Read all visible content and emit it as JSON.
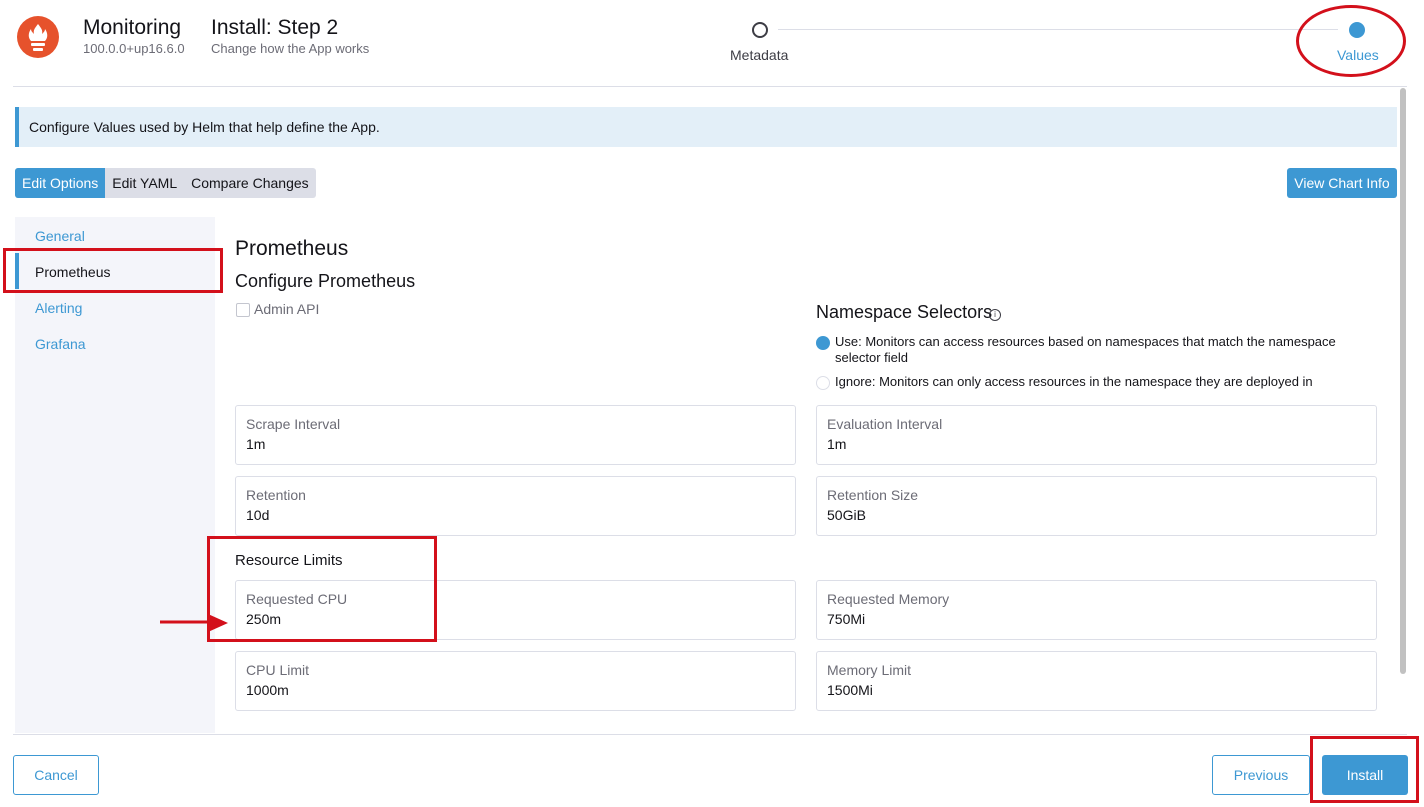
{
  "header": {
    "app_name": "Monitoring",
    "app_version": "100.0.0+up16.6.0",
    "step_title": "Install: Step 2",
    "step_subtitle": "Change how the App works",
    "steps": [
      {
        "label": "Metadata",
        "state": "complete"
      },
      {
        "label": "Values",
        "state": "active"
      }
    ],
    "logo_icon": "prometheus-logo-icon"
  },
  "banner": {
    "text": "Configure Values used by Helm that help define the App."
  },
  "tabs": [
    {
      "label": "Edit Options",
      "active": true
    },
    {
      "label": "Edit YAML",
      "active": false
    },
    {
      "label": "Compare Changes",
      "active": false
    }
  ],
  "view_chart_info": "View Chart Info",
  "sidenav": [
    {
      "label": "General",
      "active": false
    },
    {
      "label": "Prometheus",
      "active": true
    },
    {
      "label": "Alerting",
      "active": false
    },
    {
      "label": "Grafana",
      "active": false
    }
  ],
  "content": {
    "section_title": "Prometheus",
    "subsection_title": "Configure Prometheus",
    "admin_api": {
      "label": "Admin API",
      "checked": false
    },
    "namespace_selectors": {
      "title": "Namespace Selectors",
      "info_icon": "info-icon",
      "options": [
        {
          "label": "Use: Monitors can access resources based on namespaces that match the namespace selector field",
          "selected": true
        },
        {
          "label": "Ignore: Monitors can only access resources in the namespace they are deployed in",
          "selected": false
        }
      ]
    },
    "fields": {
      "scrape_interval": {
        "label": "Scrape Interval",
        "value": "1m"
      },
      "evaluation_interval": {
        "label": "Evaluation Interval",
        "value": "1m"
      },
      "retention": {
        "label": "Retention",
        "value": "10d"
      },
      "retention_size": {
        "label": "Retention Size",
        "value": "50GiB"
      },
      "requested_cpu": {
        "label": "Requested CPU",
        "value": "250m"
      },
      "requested_memory": {
        "label": "Requested Memory",
        "value": "750Mi"
      },
      "cpu_limit": {
        "label": "CPU Limit",
        "value": "1000m"
      },
      "memory_limit": {
        "label": "Memory Limit",
        "value": "1500Mi"
      }
    },
    "resource_limits_title": "Resource Limits"
  },
  "footer": {
    "cancel": "Cancel",
    "previous": "Previous",
    "install": "Install"
  },
  "colors": {
    "accent": "#3d98d3",
    "annotation": "#d3101b",
    "logo": "#e6522c"
  }
}
